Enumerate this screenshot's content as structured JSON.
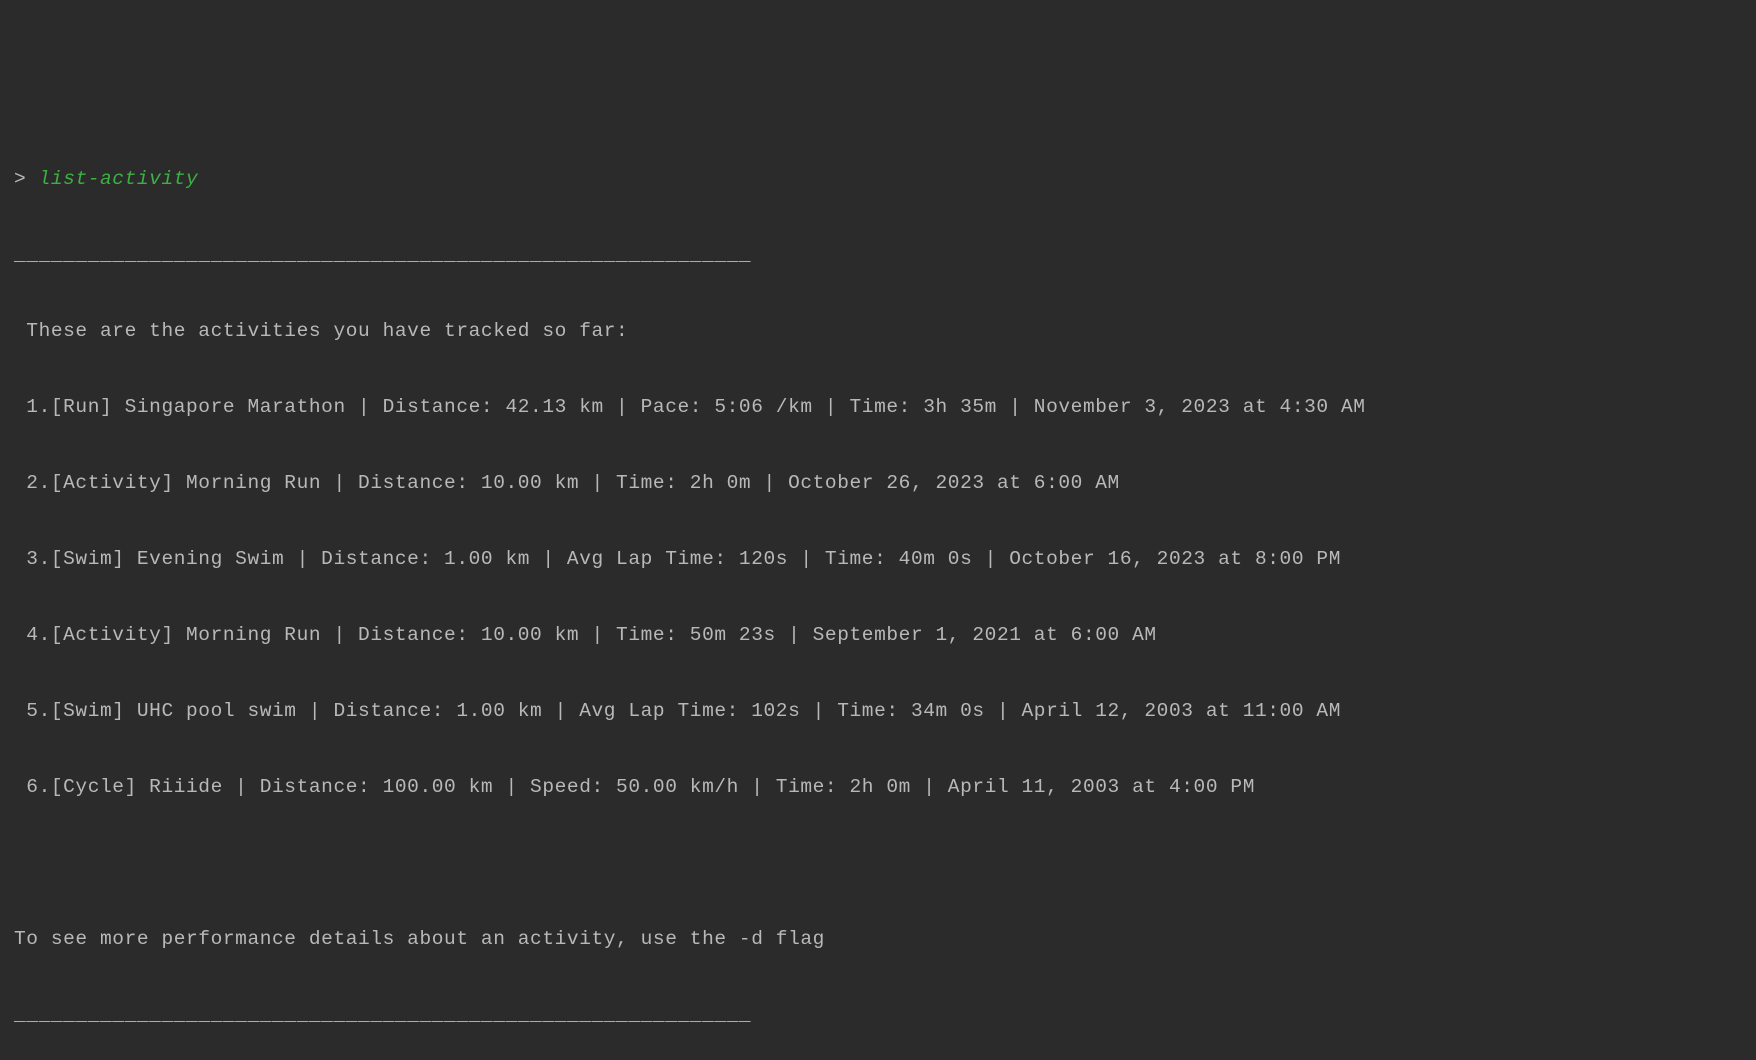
{
  "prompt": {
    "symbol": "> ",
    "command": "list-activity"
  },
  "divider": "____________________________________________________________",
  "header": " These are the activities you have tracked so far:",
  "activities": [
    " 1.[Run] Singapore Marathon | Distance: 42.13 km | Pace: 5:06 /km | Time: 3h 35m | November 3, 2023 at 4:30 AM",
    " 2.[Activity] Morning Run | Distance: 10.00 km | Time: 2h 0m | October 26, 2023 at 6:00 AM",
    " 3.[Swim] Evening Swim | Distance: 1.00 km | Avg Lap Time: 120s | Time: 40m 0s | October 16, 2023 at 8:00 PM",
    " 4.[Activity] Morning Run | Distance: 10.00 km | Time: 50m 23s | September 1, 2021 at 6:00 AM",
    " 5.[Swim] UHC pool swim | Distance: 1.00 km | Avg Lap Time: 102s | Time: 34m 0s | April 12, 2003 at 11:00 AM",
    " 6.[Cycle] Riiide | Distance: 100.00 km | Speed: 50.00 km/h | Time: 2h 0m | April 11, 2003 at 4:00 PM"
  ],
  "footer": "To see more performance details about an activity, use the -d flag",
  "divider2": "____________________________________________________________"
}
